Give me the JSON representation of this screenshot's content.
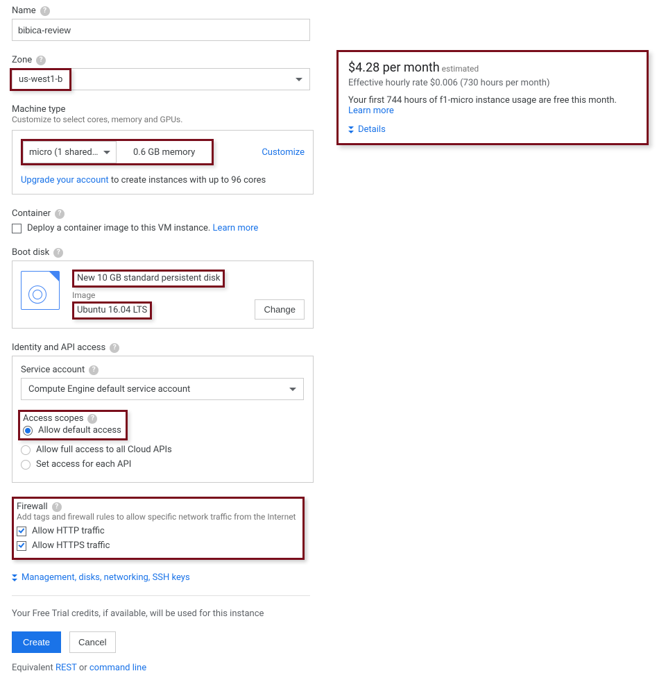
{
  "labels": {
    "name": "Name",
    "zone": "Zone",
    "machine_type": "Machine type",
    "machine_sub": "Customize to select cores, memory and GPUs.",
    "container": "Container",
    "boot_disk": "Boot disk",
    "identity": "Identity and API access",
    "service_account": "Service account",
    "access_scopes": "Access scopes",
    "firewall": "Firewall",
    "firewall_sub": "Add tags and firewall rules to allow specific network traffic from the Internet"
  },
  "name_value": "bibica-review",
  "zone_value": "us-west1-b",
  "machine": {
    "select_text": "micro (1 shared…",
    "memory": "0.6 GB memory",
    "customize": "Customize",
    "upgrade_link": "Upgrade your account",
    "upgrade_rest": " to create instances with up to 96 cores"
  },
  "container": {
    "text": "Deploy a container image to this VM instance. ",
    "learn_more": "Learn more"
  },
  "boot": {
    "disk_line": "New 10 GB standard persistent disk",
    "image_label": "Image",
    "image_value": "Ubuntu 16.04 LTS",
    "change": "Change"
  },
  "service_account_value": "Compute Engine default service account",
  "scopes": {
    "default": "Allow default access",
    "full": "Allow full access to all Cloud APIs",
    "each": "Set access for each API"
  },
  "firewall": {
    "http": "Allow HTTP traffic",
    "https": "Allow HTTPS traffic"
  },
  "expand": "Management, disks, networking, SSH keys",
  "trial_note": "Your Free Trial credits, if available, will be used for this instance",
  "buttons": {
    "create": "Create",
    "cancel": "Cancel"
  },
  "equivalent": {
    "prefix": "Equivalent ",
    "rest": "REST",
    "or": " or ",
    "cmd": "command line"
  },
  "cost": {
    "price": "$4.28 per month",
    "estimated": " estimated",
    "hourly": "Effective hourly rate $0.006 (730 hours per month)",
    "free_line": "Your first 744 hours of f1-micro instance usage are free this month. ",
    "learn_more": "Learn more",
    "details": "Details"
  }
}
